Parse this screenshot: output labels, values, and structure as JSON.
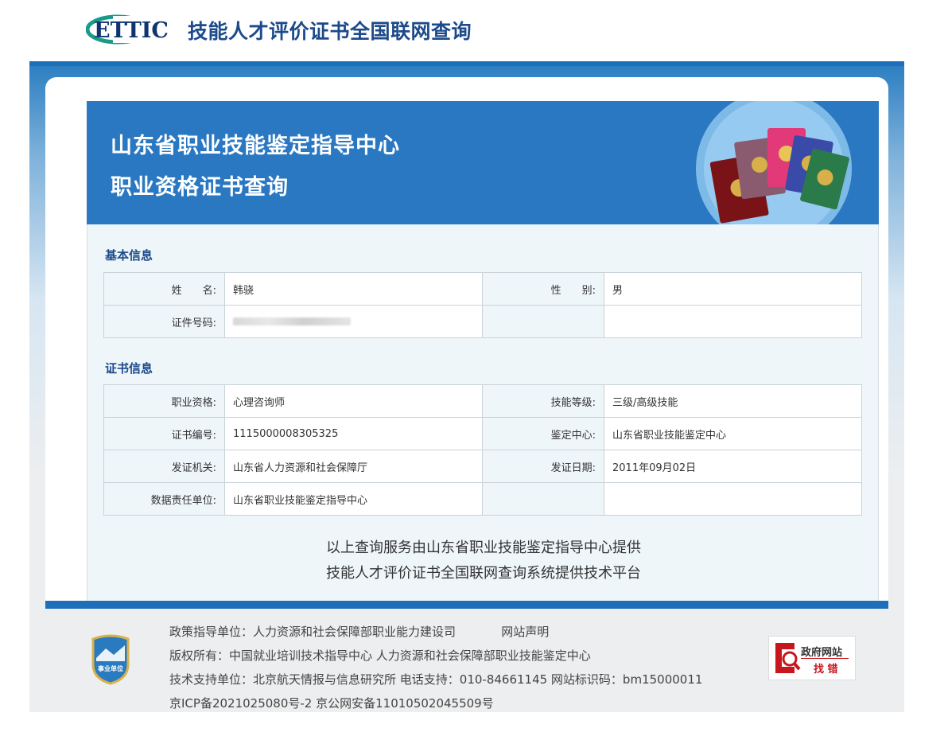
{
  "header": {
    "logo_text": "ETTIC",
    "site_title": "技能人才评价证书全国联网查询"
  },
  "banner": {
    "title_line1": "山东省职业技能鉴定指导中心",
    "title_line2": "职业资格证书查询"
  },
  "basic_info": {
    "section_title": "基本信息",
    "name_label": "姓　　名:",
    "name_value": "韩骁",
    "gender_label": "性　　别:",
    "gender_value": "男",
    "id_label": "证件号码:"
  },
  "cert_info": {
    "section_title": "证书信息",
    "rows": [
      {
        "label1": "职业资格:",
        "value1": "心理咨询师",
        "label2": "技能等级:",
        "value2": "三级/高级技能"
      },
      {
        "label1": "证书编号:",
        "value1": "1115000008305325",
        "label2": "鉴定中心:",
        "value2": "山东省职业技能鉴定中心"
      },
      {
        "label1": "发证机关:",
        "value1": "山东省人力资源和社会保障厅",
        "label2": "发证日期:",
        "value2": "2011年09月02日"
      },
      {
        "label1": "数据责任单位:",
        "value1": "山东省职业技能鉴定指导中心",
        "label2": "",
        "value2": ""
      }
    ]
  },
  "notice": {
    "line1": "以上查询服务由山东省职业技能鉴定指导中心提供",
    "line2": "技能人才评价证书全国联网查询系统提供技术平台"
  },
  "footer": {
    "badge_text": "事业单位",
    "line1_a": "政策指导单位：人力资源和社会保障部职业能力建设司",
    "line1_b": "网站声明",
    "line2": "版权所有：中国就业培训技术指导中心  人力资源和社会保障部职业技能鉴定中心",
    "line3": "技术支持单位：北京航天情报与信息研究所    电话支持：010-84661145    网站标识码：bm15000011",
    "line4": "京ICP备2021025080号-2    京公网安备11010502045509号",
    "gov_text1": "政府网站",
    "gov_text2": "找 错"
  },
  "colors": {
    "brand_blue": "#1c4a8a",
    "banner_blue": "#2a78c2",
    "accent_red": "#c8161d"
  }
}
